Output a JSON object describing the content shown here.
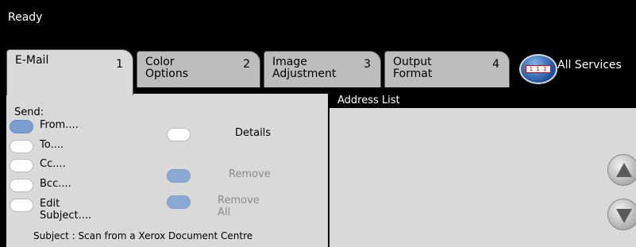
{
  "status": {
    "text": "Ready"
  },
  "tabs": [
    {
      "label": "E-Mail",
      "number": "1"
    },
    {
      "label": "Color\nOptions",
      "number": "2"
    },
    {
      "label": "Image\nAdjustment",
      "number": "3"
    },
    {
      "label": "Output\nFormat",
      "number": "4"
    }
  ],
  "all_services": {
    "label": "All Services",
    "icon": "all-services-icon",
    "icon_text": "1 1 1"
  },
  "send": {
    "label": "Send:",
    "from": "From....",
    "to": "To....",
    "cc": "Cc....",
    "bcc": "Bcc....",
    "edit_subject": "Edit Subject...."
  },
  "actions": {
    "details": "Details",
    "remove": "Remove",
    "remove_all": "Remove All"
  },
  "subject_line": "Subject : Scan from a Xerox Document Centre",
  "address_list": {
    "title": "Address List",
    "scroll_up_icon": "scroll-up-icon",
    "scroll_down_icon": "scroll-down-icon"
  }
}
